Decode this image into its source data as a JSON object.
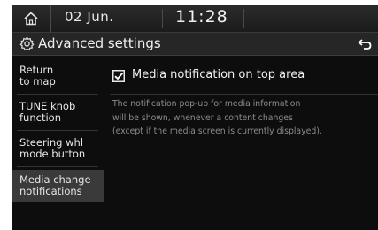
{
  "status": {
    "date": "02 Jun.",
    "time": "11:28",
    "home_icon": "home-icon"
  },
  "header": {
    "title": "Advanced settings",
    "title_icon": "gear-icon",
    "back_icon": "back-icon"
  },
  "sidebar": {
    "items": [
      {
        "label_line1": "Return",
        "label_line2": "to map",
        "active": false
      },
      {
        "label_line1": "TUNE knob",
        "label_line2": "function",
        "active": false
      },
      {
        "label_line1": "Steering whl",
        "label_line2": "mode button",
        "active": false
      },
      {
        "label_line1": "Media change",
        "label_line2": "notifications",
        "active": true
      }
    ]
  },
  "main": {
    "option": {
      "label": "Media notification on top area",
      "checked": true
    },
    "description": {
      "line1": "The notification pop-up for media information",
      "line2": "will be shown, whenever a content changes",
      "line3": "(except if the media screen is currently displayed)."
    }
  },
  "colors": {
    "background": "#0d0d0d",
    "active_item": "#3a3a3a",
    "text": "#f0f0f0",
    "description_text": "#8c8c8c"
  }
}
